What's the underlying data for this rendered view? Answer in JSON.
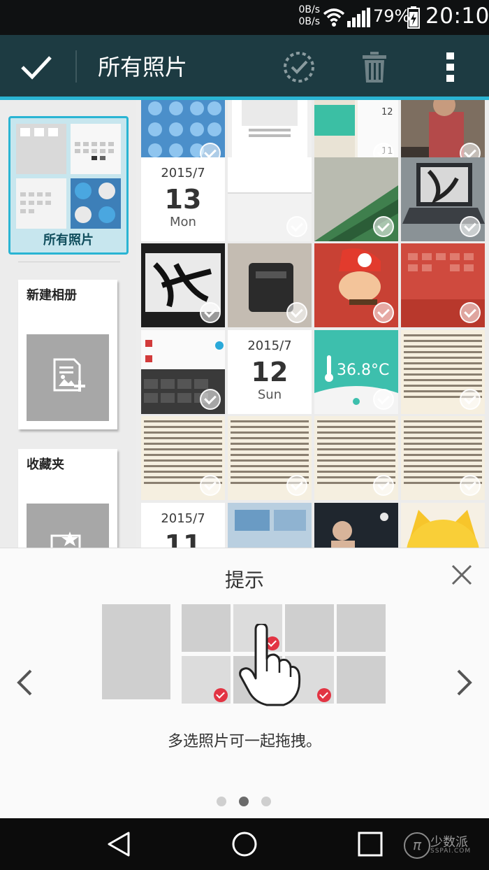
{
  "status_bar": {
    "net_speed_up": "0B/s",
    "net_speed_down": "0B/s",
    "battery_percent": "79%",
    "time": "20:10"
  },
  "toolbar": {
    "title": "所有照片",
    "icons": [
      "check-icon",
      "select-all-icon",
      "delete-icon",
      "more-icon"
    ]
  },
  "sidebar": {
    "albums": [
      {
        "label": "所有照片",
        "selected": true
      },
      {
        "label": "新建相册",
        "selected": false,
        "icon": "new-album-icon"
      },
      {
        "label": "收藏夹",
        "selected": false,
        "icon": "favorites-icon"
      }
    ]
  },
  "grid": {
    "date_headers": [
      {
        "year_month": "2015/7",
        "day": "13",
        "weekday": "Mon"
      },
      {
        "year_month": "2015/7",
        "day": "12",
        "weekday": "Sun"
      },
      {
        "year_month": "2015/7",
        "day": "11",
        "weekday": ""
      }
    ],
    "thermometer_value": "36.8°C"
  },
  "tips": {
    "title": "提示",
    "description": "多选照片可一起拖拽。",
    "page_count": 3,
    "active_page": 2
  },
  "nav_bar": {
    "buttons": [
      "back-icon",
      "home-icon",
      "recent-apps-icon"
    ],
    "watermark_brand": "少数派",
    "watermark_domain": "SSPAI.COM"
  },
  "colors": {
    "toolbar_bg": "#1d3b42",
    "accent": "#2ab4d3",
    "check_red": "#e23443"
  }
}
